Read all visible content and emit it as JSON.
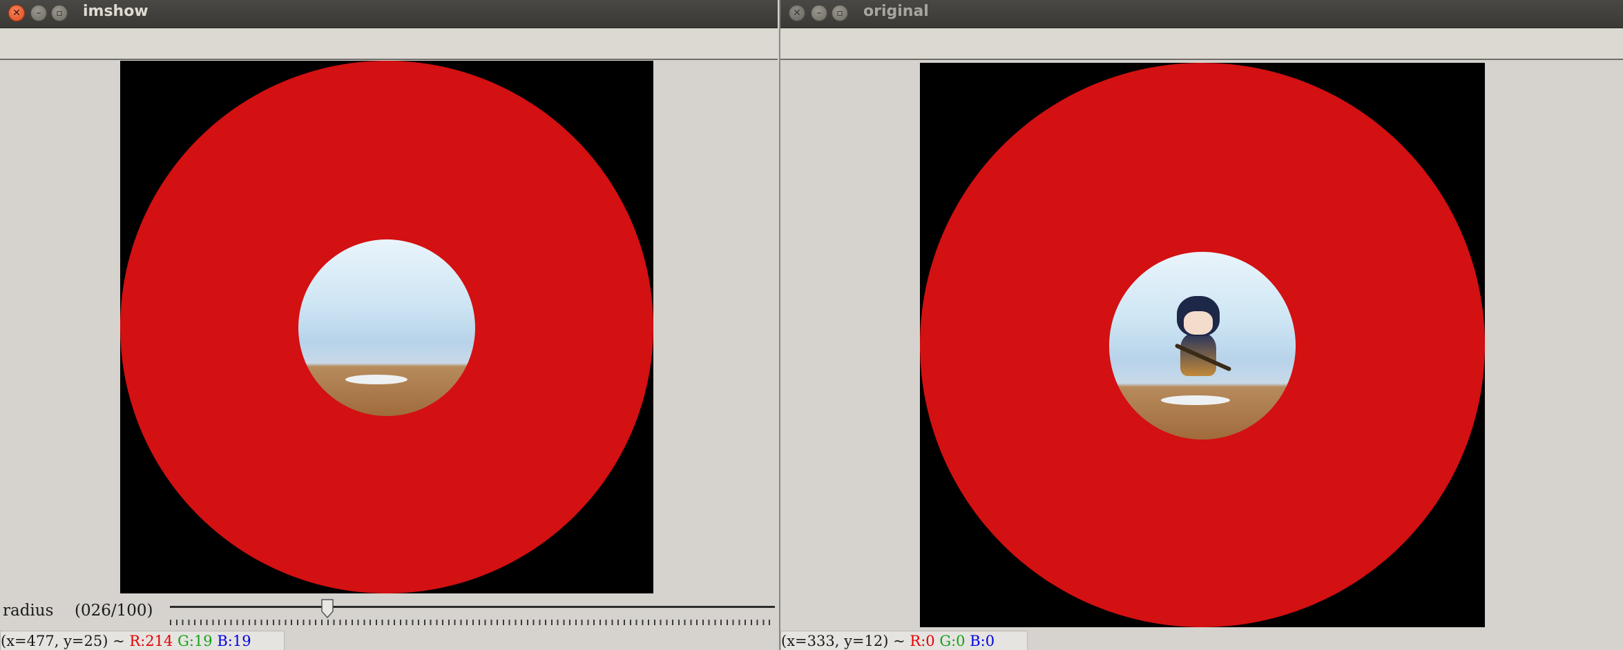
{
  "windows": {
    "imshow": {
      "title": "imshow",
      "trackbar": {
        "name": "radius",
        "value_text": "(026/100)",
        "value": 26,
        "max": 100
      },
      "status": {
        "coords": "(x=477, y=25) ~ ",
        "r": "R:214",
        "g": "G:19",
        "b": "B:19"
      }
    },
    "original": {
      "title": "original",
      "status": {
        "coords": "(x=333, y=12) ~ ",
        "r": "R:0",
        "g": "G:0",
        "b": "B:0"
      }
    }
  },
  "icons": {
    "close": "close-icon",
    "minimize": "minimize-icon",
    "maximize": "maximize-icon"
  },
  "colors": {
    "ring": "#d31012",
    "canvas_background": "#000000",
    "window_chrome": "#3f3e3a",
    "active_close_button": "#de4b1c"
  }
}
